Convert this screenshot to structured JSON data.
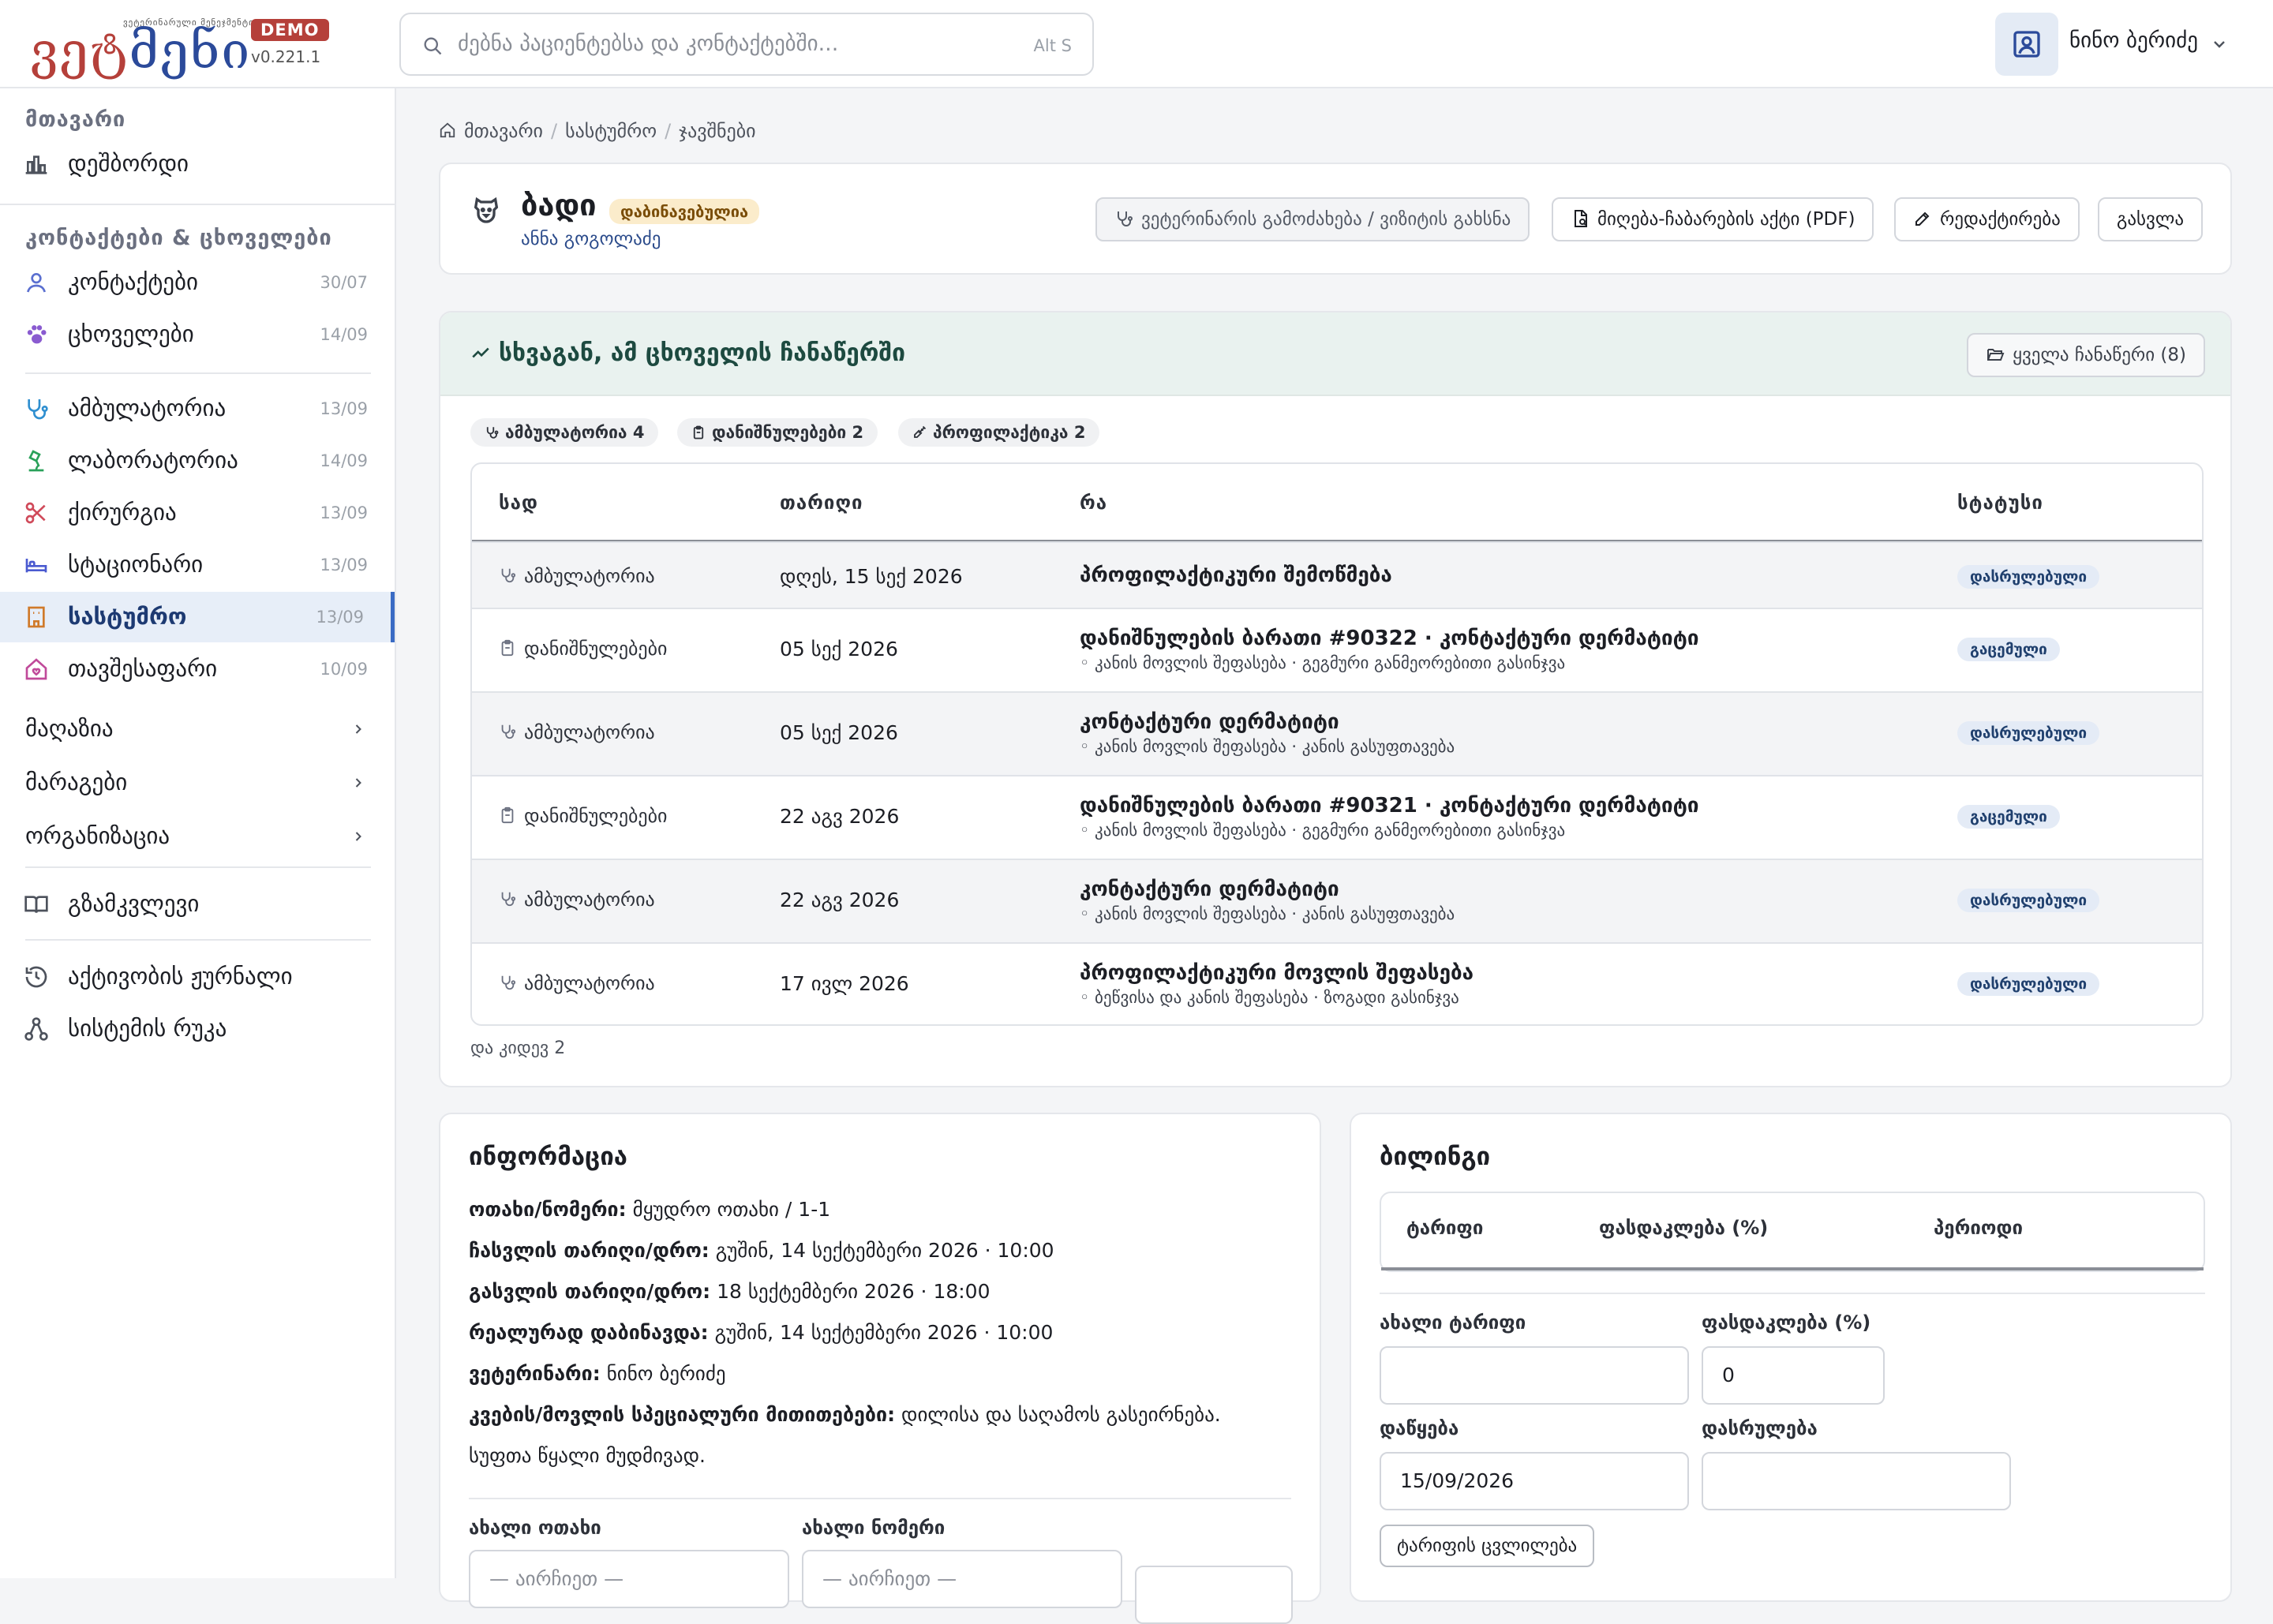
{
  "app": {
    "logo_tagline": "ვეტერინარული მენეჯმენტი",
    "logo_text_a": "ვეტ",
    "logo_text_b": "მენი",
    "demo_badge": "DEMO",
    "version": "v0.221.1",
    "brand_color": "#b5403a",
    "accent_color": "#3a6bc4"
  },
  "search": {
    "placeholder": "ძებნა პაციენტებსა და კონტაქტებში...",
    "shortcut": "Alt S"
  },
  "user": {
    "name": "ნინო ბერიძე"
  },
  "sidebar": {
    "section_main": "მთავარი",
    "dashboard": "დეშბორდი",
    "section_contacts": "კონტაქტები & ცხოველები",
    "contacts": {
      "label": "კონტაქტები",
      "count": "30/07"
    },
    "animals": {
      "label": "ცხოველები",
      "count": "14/09"
    },
    "outpatient": {
      "label": "ამბულატორია",
      "count": "13/09"
    },
    "lab": {
      "label": "ლაბორატორია",
      "count": "14/09"
    },
    "surgery": {
      "label": "ქირურგია",
      "count": "13/09"
    },
    "inpatient": {
      "label": "სტაციონარი",
      "count": "13/09"
    },
    "hotel": {
      "label": "სასტუმრო",
      "count": "13/09"
    },
    "shelter": {
      "label": "თავშესაფარი",
      "count": "10/09"
    },
    "shop": "მაღაზია",
    "stock": "მარაგები",
    "organization": "ორგანიზაცია",
    "guide": "გზამკვლევი",
    "activity_log": "აქტივობის ჟურნალი",
    "system_map": "სისტემის რუკა"
  },
  "breadcrumb": {
    "home": "მთავარი",
    "hotel": "სასტუმრო",
    "bookings": "ჯავშნები"
  },
  "header": {
    "pet_name": "ბადი",
    "status_badge": "დაბინავებულია",
    "owner": "ანნა გოგოლაძე",
    "btn_call_vet": "ვეტერინარის გამოძახება / ვიზიტის გახსნა",
    "btn_pdf": "მიღება-ჩაბარების აქტი (PDF)",
    "btn_edit": "რედაქტირება",
    "btn_checkout": "გასვლა"
  },
  "other_records": {
    "title": "სხვაგან, ამ ცხოველის ჩანაწერში",
    "all_button": "ყველა ჩანაწერი (8)",
    "chips": {
      "outpatient": "ამბულატორია 4",
      "prescriptions": "დანიშნულებები 2",
      "prophylaxis": "პროფილაქტიკა 2"
    },
    "columns": {
      "where": "სად",
      "date": "თარიღი",
      "what": "რა",
      "status": "სტატუსი"
    },
    "rows": [
      {
        "where": "ამბულატორია",
        "date": "დღეს, 15 სექ 2026",
        "what": "პროფილაქტიკური შემოწმება",
        "sub": "",
        "status": "დასრულებული"
      },
      {
        "where": "დანიშნულებები",
        "date": "05 სექ 2026",
        "what": "დანიშნულების ბარათი #90322 · კონტაქტური დერმატიტი",
        "sub": "◦ კანის მოვლის შეფასება · გეგმური განმეორებითი გასინჯვა",
        "status": "გაცემული"
      },
      {
        "where": "ამბულატორია",
        "date": "05 სექ 2026",
        "what": "კონტაქტური დერმატიტი",
        "sub": "◦ კანის მოვლის შეფასება · კანის გასუფთავება",
        "status": "დასრულებული"
      },
      {
        "where": "დანიშნულებები",
        "date": "22 აგვ 2026",
        "what": "დანიშნულების ბარათი #90321 · კონტაქტური დერმატიტი",
        "sub": "◦ კანის მოვლის შეფასება · გეგმური განმეორებითი გასინჯვა",
        "status": "გაცემული"
      },
      {
        "where": "ამბულატორია",
        "date": "22 აგვ 2026",
        "what": "კონტაქტური დერმატიტი",
        "sub": "◦ კანის მოვლის შეფასება · კანის გასუფთავება",
        "status": "დასრულებული"
      },
      {
        "where": "ამბულატორია",
        "date": "17 ივლ 2026",
        "what": "პროფილაქტიკური მოვლის შეფასება",
        "sub": "◦ ბეწვისა და კანის შეფასება · ზოგადი გასინჯვა",
        "status": "დასრულებული"
      }
    ],
    "more": "და კიდევ 2"
  },
  "info": {
    "title": "ინფორმაცია",
    "room_label": "ოთახი/ნომერი:",
    "room_value": "მყუდრო ოთახი / 1-1",
    "arrival_label": "ჩასვლის თარიღი/დრო:",
    "arrival_value": "გუშინ, 14 სექტემბერი 2026 · 10:00",
    "departure_label": "გასვლის თარიღი/დრო:",
    "departure_value": "18 სექტემბერი 2026 · 18:00",
    "actual_label": "რეალურად დაბინავდა:",
    "actual_value": "გუშინ, 14 სექტემბერი 2026 · 10:00",
    "vet_label": "ვეტერინარი:",
    "vet_value": "ნინო ბერიძე",
    "notes_label": "კვების/მოვლის სპეციალური მითითებები:",
    "notes_value_1": "დილისა და საღამოს გასეირნება.",
    "notes_value_2": "სუფთა წყალი მუდმივად.",
    "new_room_label": "ახალი ოთახი",
    "new_number_label": "ახალი ნომერი",
    "select_placeholder": "— აირჩიეთ —"
  },
  "billing": {
    "title": "ბილინგი",
    "col_tariff": "ტარიფი",
    "col_discount": "ფასდაკლება (%)",
    "col_period": "პერიოდი",
    "new_tariff_label": "ახალი ტარიფი",
    "discount_label": "ფასდაკლება (%)",
    "discount_value": "0",
    "start_label": "დაწყება",
    "start_value": "15/09/2026",
    "end_label": "დასრულება",
    "change_button": "ტარიფის ცვლილება"
  }
}
